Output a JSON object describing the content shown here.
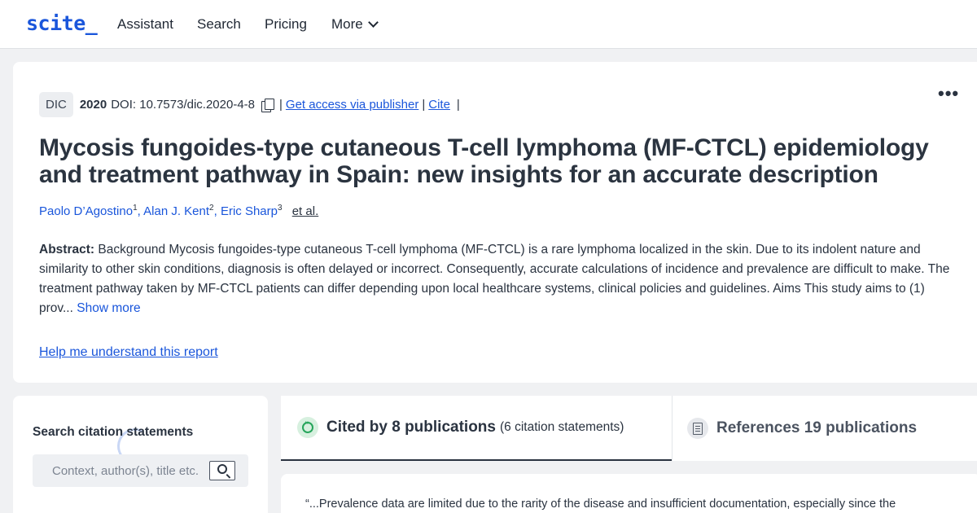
{
  "nav": {
    "logo": "scite_",
    "items": [
      "Assistant",
      "Search",
      "Pricing"
    ],
    "more": "More"
  },
  "article": {
    "journal": "DIC",
    "year": "2020",
    "doi": "DOI: 10.7573/dic.2020-4-8",
    "sep": "|",
    "access_link": "Get access via publisher",
    "cite_link": "Cite",
    "title": "Mycosis fungoides-type cutaneous T-cell lymphoma (MF-CTCL) epidemiology and treatment pathway in Spain: new insights for an accurate description",
    "authors": [
      {
        "name": "Paolo D’Agostino",
        "sup": "1"
      },
      {
        "name": "Alan J. Kent",
        "sup": "2"
      },
      {
        "name": "Eric Sharp",
        "sup": "3"
      }
    ],
    "et_al": "et al.",
    "abstract_label": "Abstract:",
    "abstract_text": "Background Mycosis fungoides-type cutaneous T-cell lymphoma (MF-CTCL) is a rare lymphoma localized in the skin. Due to its indolent nature and similarity to other skin conditions, diagnosis is often delayed or incorrect. Consequently, accurate calculations of incidence and prevalence are difficult to make. The treatment pathway taken by MF-CTCL patients can differ depending upon local healthcare systems, clinical policies and guidelines. Aims This study aims to (1) prov...",
    "show_more": "Show more",
    "help_link": "Help me understand this report",
    "menu_dots": "•••"
  },
  "search_panel": {
    "label": "Search citation statements",
    "placeholder": "Context, author(s), title etc."
  },
  "tabs": {
    "cited_title": "Cited by 8 publications",
    "cited_sub": "(6 citation statements)",
    "refs_title": "References 19 publications"
  },
  "quote": {
    "text": "“...Prevalence data are limited due to the rarity of the disease and insufficient documentation, especially since the"
  },
  "colors": {
    "link": "#1a56db",
    "background": "#f0f1f3",
    "accent_green": "#25a55a"
  }
}
